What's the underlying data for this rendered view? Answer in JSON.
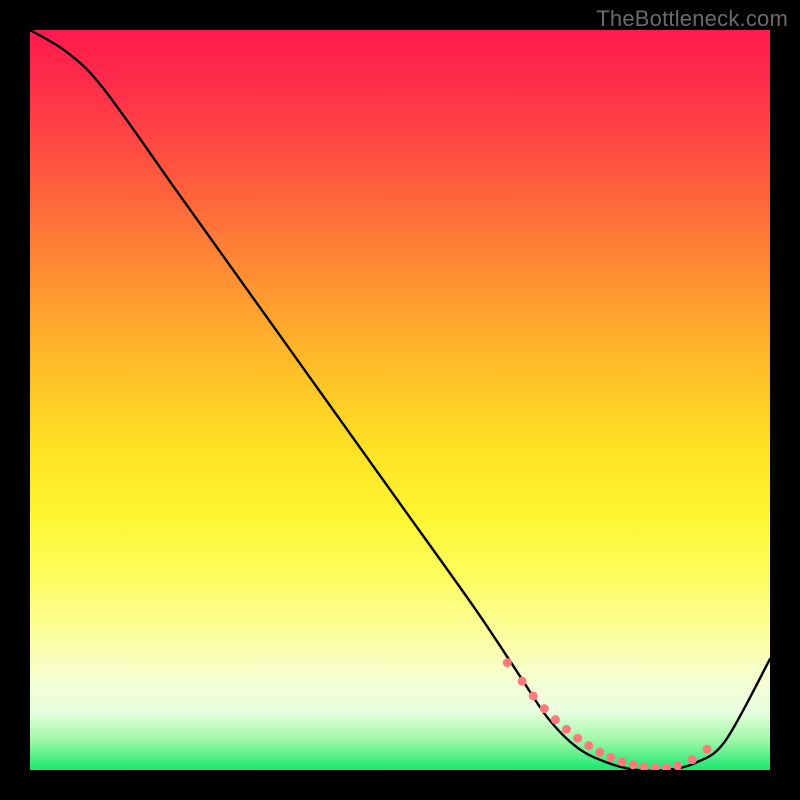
{
  "watermark": "TheBottleneck.com",
  "chart_data": {
    "type": "line",
    "title": "",
    "xlabel": "",
    "ylabel": "",
    "xlim": [
      0,
      100
    ],
    "ylim": [
      0,
      100
    ],
    "grid": false,
    "legend": false,
    "series": [
      {
        "name": "bottleneck-curve",
        "color": "#000000",
        "x": [
          0,
          5,
          10,
          20,
          30,
          40,
          50,
          60,
          66,
          70,
          74,
          78,
          82,
          86,
          90,
          94,
          100
        ],
        "y": [
          100,
          97,
          92,
          78,
          64,
          50,
          36,
          22,
          13,
          7,
          3,
          1,
          0,
          0,
          1,
          4,
          15
        ]
      }
    ],
    "markers": {
      "name": "trough-dots",
      "color": "#ff7b7b",
      "radius": 4.5,
      "x": [
        64.5,
        66.5,
        68,
        69.5,
        71,
        72.5,
        74,
        75.5,
        77,
        78.5,
        80,
        81.5,
        83,
        84.5,
        86,
        87.5,
        89.5,
        91.5
      ],
      "y": [
        14.5,
        12,
        10,
        8.3,
        6.8,
        5.5,
        4.3,
        3.3,
        2.4,
        1.7,
        1.1,
        0.7,
        0.4,
        0.3,
        0.3,
        0.6,
        1.4,
        2.8
      ]
    },
    "background_gradient": {
      "top": "#ff1a4d",
      "mid": "#fff733",
      "bottom": "#17e86e"
    }
  }
}
